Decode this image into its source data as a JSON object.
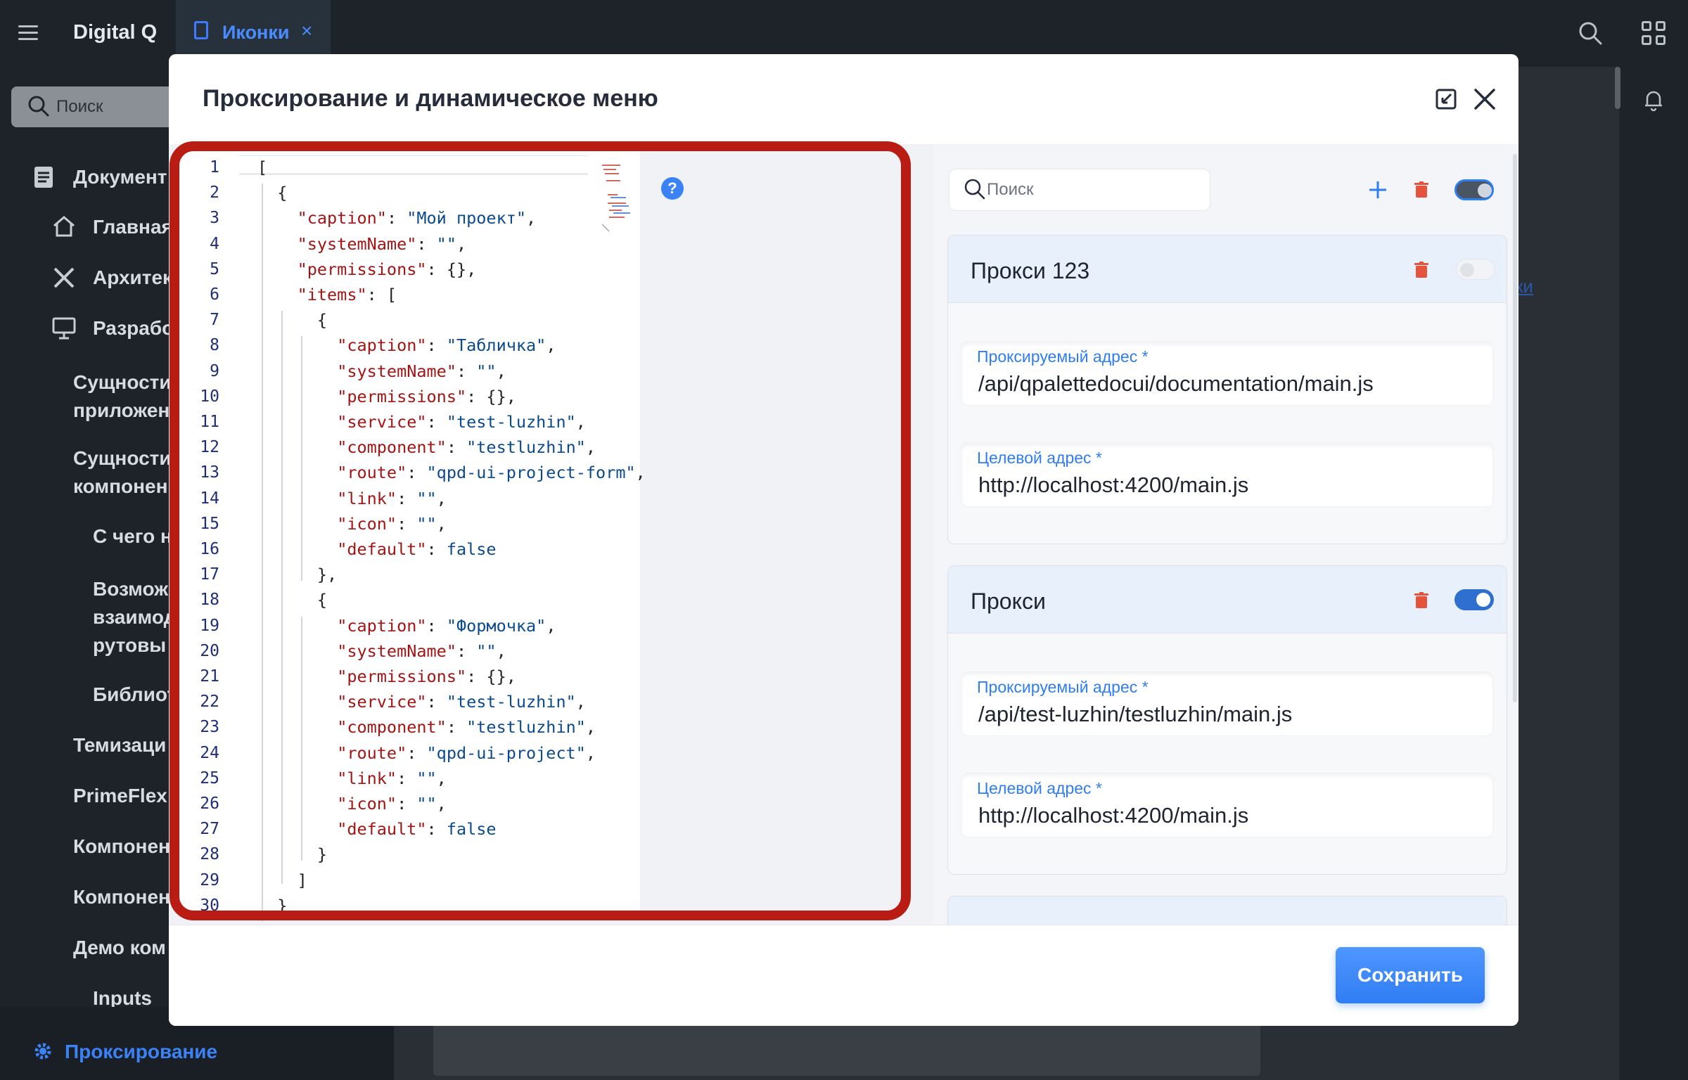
{
  "app": {
    "title": "Digital Q",
    "tab_label": "Иконки",
    "tab_close": "×"
  },
  "sidebar": {
    "search_placeholder": "Поиск",
    "items": [
      {
        "label": "Документ",
        "icon": "document-icon"
      },
      {
        "label": "Главная",
        "icon": "home-icon"
      },
      {
        "label": "Архитек",
        "icon": "tools-icon"
      },
      {
        "label": "Разрабо",
        "icon": "monitor-icon"
      },
      {
        "label": "Сущности приложен"
      },
      {
        "label": "Сущности компонен"
      },
      {
        "label": "С чего н"
      },
      {
        "label": "Возмож взаимод рутовы"
      },
      {
        "label": "Библиот"
      },
      {
        "label": "Темизаци"
      },
      {
        "label": "PrimeFlex"
      },
      {
        "label": "Компонен"
      },
      {
        "label": "Компонен"
      },
      {
        "label": "Демо ком"
      },
      {
        "label": "Inputs"
      }
    ],
    "bottom_item": "Проксирование"
  },
  "background": {
    "link_fragment": "ки"
  },
  "modal": {
    "title": "Проксирование и динамическое меню",
    "save_label": "Сохранить",
    "help": "?"
  },
  "editor": {
    "lines": [
      "[",
      "  {",
      "    \"caption\": \"Мой проект\",",
      "    \"systemName\": \"\",",
      "    \"permissions\": {},",
      "    \"items\": [",
      "      {",
      "        \"caption\": \"Табличка\",",
      "        \"systemName\": \"\",",
      "        \"permissions\": {},",
      "        \"service\": \"test-luzhin\",",
      "        \"component\": \"testluzhin\",",
      "        \"route\": \"qpd-ui-project-form\",",
      "        \"link\": \"\",",
      "        \"icon\": \"\",",
      "        \"default\": false",
      "      },",
      "      {",
      "        \"caption\": \"Формочка\",",
      "        \"systemName\": \"\",",
      "        \"permissions\": {},",
      "        \"service\": \"test-luzhin\",",
      "        \"component\": \"testluzhin\",",
      "        \"route\": \"qpd-ui-project\",",
      "        \"link\": \"\",",
      "        \"icon\": \"\",",
      "        \"default\": false",
      "      }",
      "    ]",
      "  }"
    ]
  },
  "proxies": {
    "search_placeholder": "Поиск",
    "global_toggle_on": true,
    "source_label": "Проксируемый адрес *",
    "target_label": "Целевой адрес *",
    "items": [
      {
        "name": "Прокси 123",
        "enabled": false,
        "source": "/api/qpalettedocui/documentation/main.js",
        "target": "http://localhost:4200/main.js"
      },
      {
        "name": "Прокси",
        "enabled": true,
        "source": "/api/test-luzhin/testluzhin/main.js",
        "target": "http://localhost:4200/main.js"
      }
    ]
  },
  "colors": {
    "accent": "#2f7df3",
    "highlight_frame": "#b81c12",
    "json_key": "#a31515",
    "json_value": "#0c4a8e",
    "danger": "#e5533d"
  }
}
